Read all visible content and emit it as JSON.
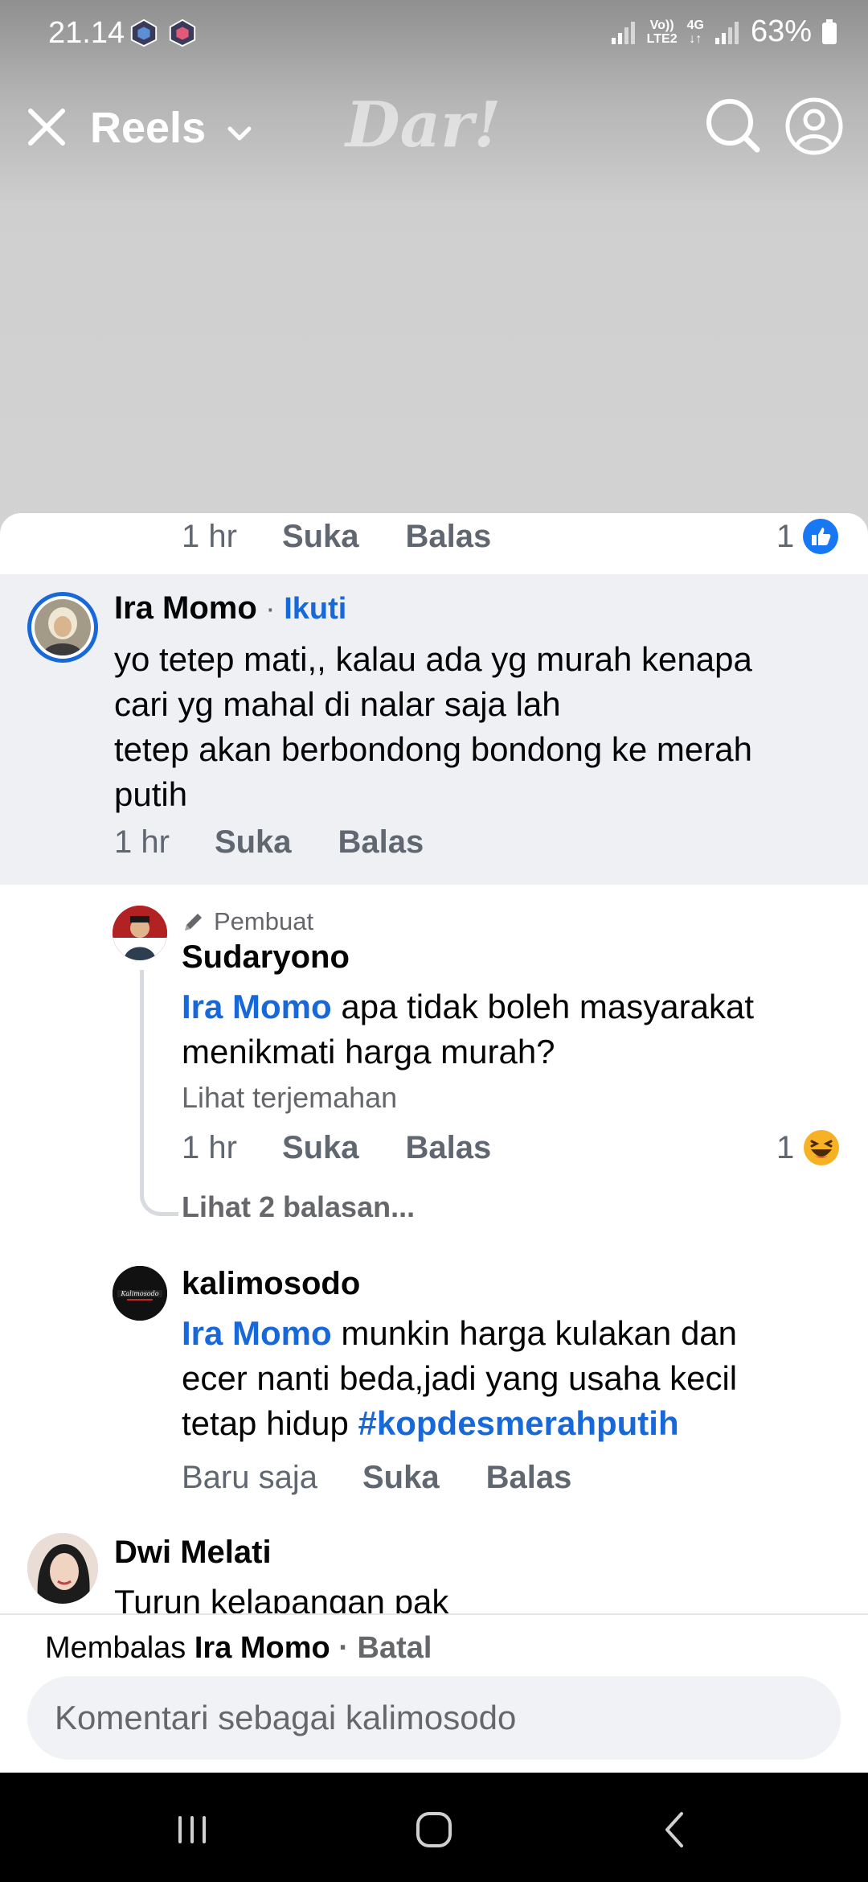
{
  "status_bar": {
    "time": "21.14",
    "volte_label_1": "Vo))",
    "volte_label_2": "LTE2",
    "network_label": "4G",
    "battery_percent": "63%"
  },
  "header": {
    "title": "Reels",
    "watermark": "Dar!"
  },
  "comments": {
    "top_meta": {
      "time": "1 hr",
      "like": "Suka",
      "reply": "Balas",
      "reaction_count": "1"
    },
    "main_comment": {
      "author": "Ira Momo",
      "separator": "·",
      "follow": "Ikuti",
      "lines": [
        "yo tetep mati,, kalau ada yg murah kenapa",
        "cari yg mahal di nalar saja lah",
        "tetep akan berbondong bondong ke merah",
        "putih"
      ],
      "time": "1 hr",
      "like": "Suka",
      "reply": "Balas"
    },
    "reply_creator": {
      "badge": "Pembuat",
      "author": "Sudaryono",
      "mention": "Ira Momo",
      "line1_rest": " apa tidak boleh masyarakat",
      "line2": "menikmati harga murah?",
      "translate": "Lihat terjemahan",
      "time": "1 hr",
      "like": "Suka",
      "reply": "Balas",
      "reaction_count": "1",
      "view_replies": "Lihat 2 balasan..."
    },
    "reply_page": {
      "author": "kalimosodo",
      "avatar_text": "Kalimosodo",
      "mention": "Ira Momo",
      "line1_rest": " munkin harga kulakan dan",
      "line2": "ecer nanti beda,jadi yang usaha kecil",
      "line3_prefix": "tetap hidup ",
      "hashtag": "#kopdesmerahputih",
      "time": "Baru saja",
      "like": "Suka",
      "reply": "Balas"
    },
    "next_comment": {
      "author": "Dwi Melati",
      "text": "Turun kelapangan pak"
    }
  },
  "composer": {
    "replying_prefix": "Membalas ",
    "replying_to": "Ira Momo",
    "separator": " · ",
    "cancel": "Batal",
    "placeholder": "Komentari sebagai kalimosodo"
  },
  "colors": {
    "accent": "#1768d8",
    "highlight_bg": "#eef0f4",
    "secondary_text": "#65676b"
  }
}
